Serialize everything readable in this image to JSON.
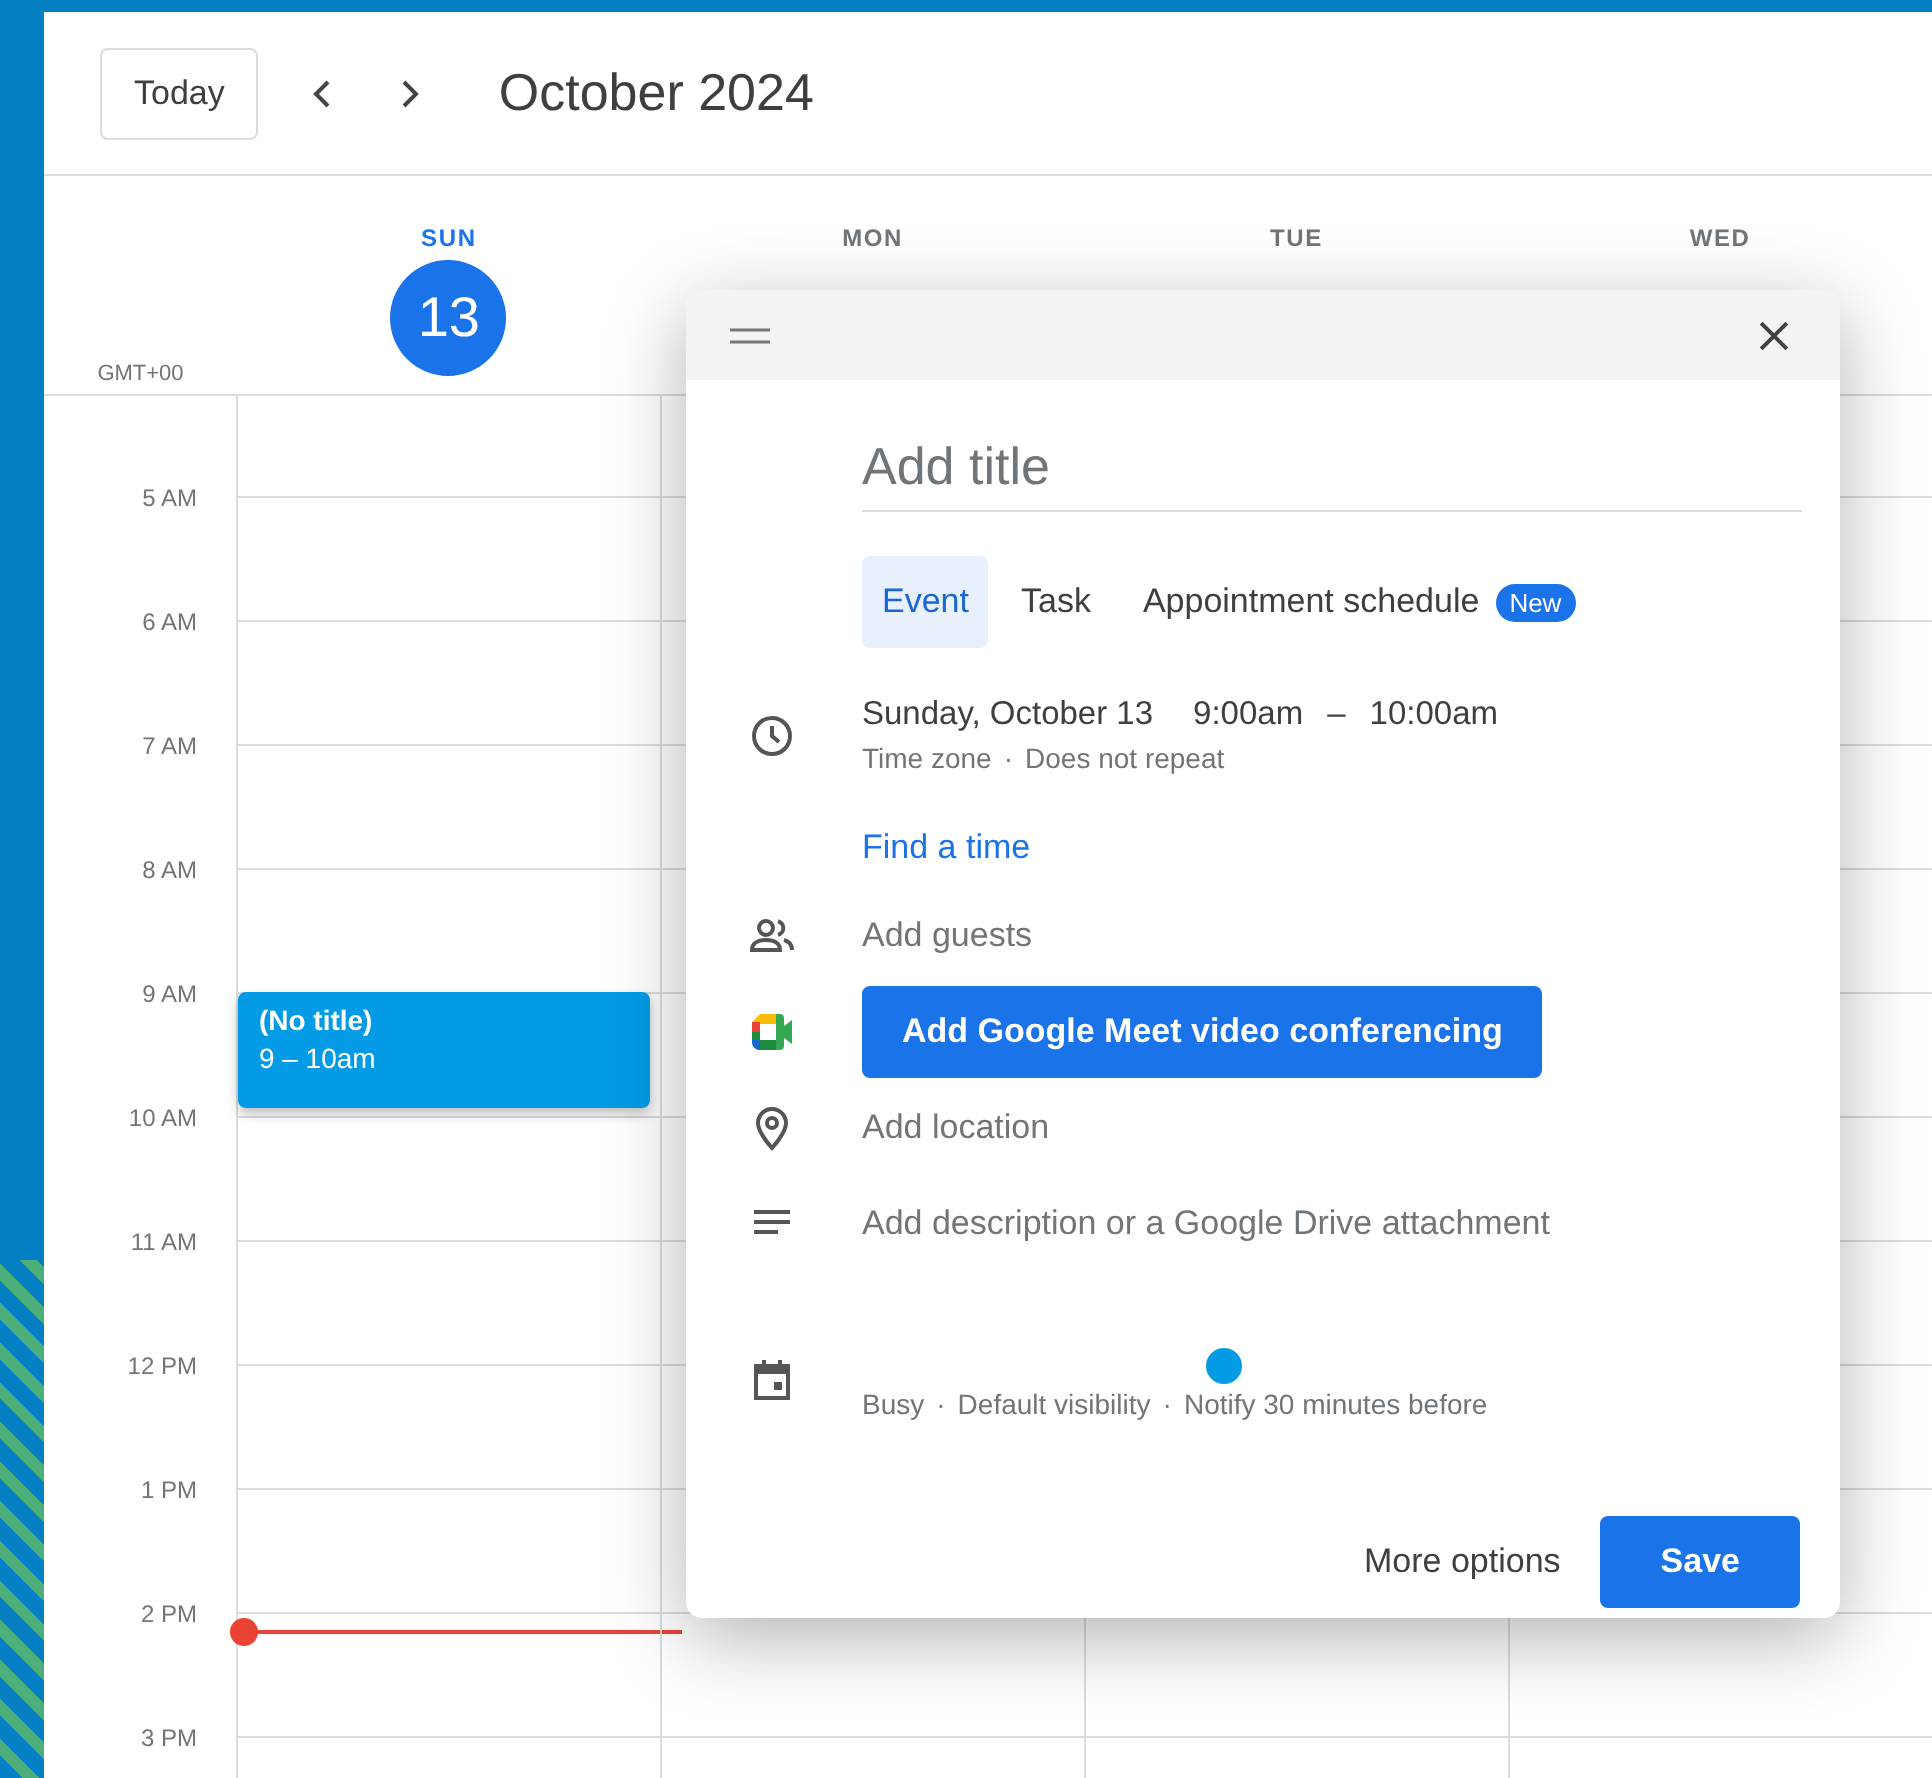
{
  "toolbar": {
    "today": "Today",
    "title": "October 2024"
  },
  "days": [
    {
      "abbr": "SUN",
      "date": "13",
      "selected": true
    },
    {
      "abbr": "MON",
      "selected": false
    },
    {
      "abbr": "TUE",
      "selected": false
    },
    {
      "abbr": "WED",
      "selected": false
    }
  ],
  "timezone": "GMT+00",
  "hours": [
    "5 AM",
    "6 AM",
    "7 AM",
    "8 AM",
    "9 AM",
    "10 AM",
    "11 AM",
    "12 PM",
    "1 PM",
    "2 PM",
    "3 PM"
  ],
  "event": {
    "title": "(No title)",
    "time": "9 – 10am"
  },
  "dialog": {
    "title_placeholder": "Add title",
    "tabs": [
      {
        "label": "Event",
        "selected": true
      },
      {
        "label": "Task",
        "selected": false
      },
      {
        "label": "Appointment schedule",
        "selected": false,
        "badge": "New"
      }
    ],
    "when": {
      "date": "Sunday, October 13",
      "start": "9:00am",
      "dash": "–",
      "end": "10:00am"
    },
    "separator": "·",
    "when_options": [
      "Time zone",
      "Does not repeat"
    ],
    "find_time": "Find a time",
    "guests": "Add guests",
    "meet": "Add Google Meet video conferencing",
    "location": "Add location",
    "description": "Add description or a Google Drive attachment",
    "status": [
      "Busy",
      "Default visibility",
      "Notify 30 minutes before"
    ],
    "more_options": "More options",
    "save": "Save"
  }
}
